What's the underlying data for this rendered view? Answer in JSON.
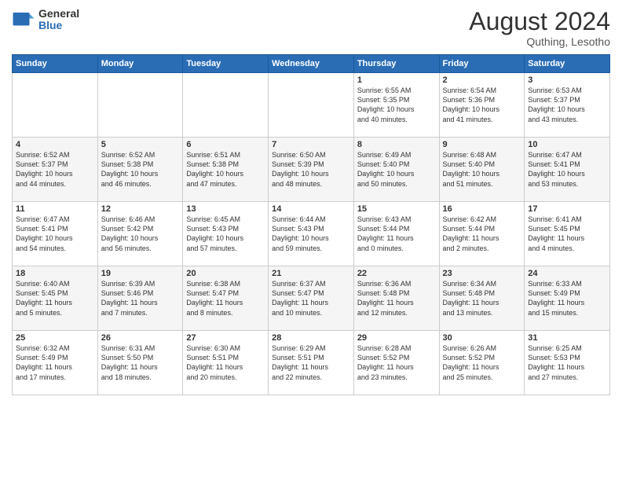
{
  "logo": {
    "general": "General",
    "blue": "Blue"
  },
  "title": {
    "month_year": "August 2024",
    "location": "Quthing, Lesotho"
  },
  "headers": [
    "Sunday",
    "Monday",
    "Tuesday",
    "Wednesday",
    "Thursday",
    "Friday",
    "Saturday"
  ],
  "weeks": [
    [
      {
        "day": "",
        "content": ""
      },
      {
        "day": "",
        "content": ""
      },
      {
        "day": "",
        "content": ""
      },
      {
        "day": "",
        "content": ""
      },
      {
        "day": "1",
        "content": "Sunrise: 6:55 AM\nSunset: 5:35 PM\nDaylight: 10 hours\nand 40 minutes."
      },
      {
        "day": "2",
        "content": "Sunrise: 6:54 AM\nSunset: 5:36 PM\nDaylight: 10 hours\nand 41 minutes."
      },
      {
        "day": "3",
        "content": "Sunrise: 6:53 AM\nSunset: 5:37 PM\nDaylight: 10 hours\nand 43 minutes."
      }
    ],
    [
      {
        "day": "4",
        "content": "Sunrise: 6:52 AM\nSunset: 5:37 PM\nDaylight: 10 hours\nand 44 minutes."
      },
      {
        "day": "5",
        "content": "Sunrise: 6:52 AM\nSunset: 5:38 PM\nDaylight: 10 hours\nand 46 minutes."
      },
      {
        "day": "6",
        "content": "Sunrise: 6:51 AM\nSunset: 5:38 PM\nDaylight: 10 hours\nand 47 minutes."
      },
      {
        "day": "7",
        "content": "Sunrise: 6:50 AM\nSunset: 5:39 PM\nDaylight: 10 hours\nand 48 minutes."
      },
      {
        "day": "8",
        "content": "Sunrise: 6:49 AM\nSunset: 5:40 PM\nDaylight: 10 hours\nand 50 minutes."
      },
      {
        "day": "9",
        "content": "Sunrise: 6:48 AM\nSunset: 5:40 PM\nDaylight: 10 hours\nand 51 minutes."
      },
      {
        "day": "10",
        "content": "Sunrise: 6:47 AM\nSunset: 5:41 PM\nDaylight: 10 hours\nand 53 minutes."
      }
    ],
    [
      {
        "day": "11",
        "content": "Sunrise: 6:47 AM\nSunset: 5:41 PM\nDaylight: 10 hours\nand 54 minutes."
      },
      {
        "day": "12",
        "content": "Sunrise: 6:46 AM\nSunset: 5:42 PM\nDaylight: 10 hours\nand 56 minutes."
      },
      {
        "day": "13",
        "content": "Sunrise: 6:45 AM\nSunset: 5:43 PM\nDaylight: 10 hours\nand 57 minutes."
      },
      {
        "day": "14",
        "content": "Sunrise: 6:44 AM\nSunset: 5:43 PM\nDaylight: 10 hours\nand 59 minutes."
      },
      {
        "day": "15",
        "content": "Sunrise: 6:43 AM\nSunset: 5:44 PM\nDaylight: 11 hours\nand 0 minutes."
      },
      {
        "day": "16",
        "content": "Sunrise: 6:42 AM\nSunset: 5:44 PM\nDaylight: 11 hours\nand 2 minutes."
      },
      {
        "day": "17",
        "content": "Sunrise: 6:41 AM\nSunset: 5:45 PM\nDaylight: 11 hours\nand 4 minutes."
      }
    ],
    [
      {
        "day": "18",
        "content": "Sunrise: 6:40 AM\nSunset: 5:45 PM\nDaylight: 11 hours\nand 5 minutes."
      },
      {
        "day": "19",
        "content": "Sunrise: 6:39 AM\nSunset: 5:46 PM\nDaylight: 11 hours\nand 7 minutes."
      },
      {
        "day": "20",
        "content": "Sunrise: 6:38 AM\nSunset: 5:47 PM\nDaylight: 11 hours\nand 8 minutes."
      },
      {
        "day": "21",
        "content": "Sunrise: 6:37 AM\nSunset: 5:47 PM\nDaylight: 11 hours\nand 10 minutes."
      },
      {
        "day": "22",
        "content": "Sunrise: 6:36 AM\nSunset: 5:48 PM\nDaylight: 11 hours\nand 12 minutes."
      },
      {
        "day": "23",
        "content": "Sunrise: 6:34 AM\nSunset: 5:48 PM\nDaylight: 11 hours\nand 13 minutes."
      },
      {
        "day": "24",
        "content": "Sunrise: 6:33 AM\nSunset: 5:49 PM\nDaylight: 11 hours\nand 15 minutes."
      }
    ],
    [
      {
        "day": "25",
        "content": "Sunrise: 6:32 AM\nSunset: 5:49 PM\nDaylight: 11 hours\nand 17 minutes."
      },
      {
        "day": "26",
        "content": "Sunrise: 6:31 AM\nSunset: 5:50 PM\nDaylight: 11 hours\nand 18 minutes."
      },
      {
        "day": "27",
        "content": "Sunrise: 6:30 AM\nSunset: 5:51 PM\nDaylight: 11 hours\nand 20 minutes."
      },
      {
        "day": "28",
        "content": "Sunrise: 6:29 AM\nSunset: 5:51 PM\nDaylight: 11 hours\nand 22 minutes."
      },
      {
        "day": "29",
        "content": "Sunrise: 6:28 AM\nSunset: 5:52 PM\nDaylight: 11 hours\nand 23 minutes."
      },
      {
        "day": "30",
        "content": "Sunrise: 6:26 AM\nSunset: 5:52 PM\nDaylight: 11 hours\nand 25 minutes."
      },
      {
        "day": "31",
        "content": "Sunrise: 6:25 AM\nSunset: 5:53 PM\nDaylight: 11 hours\nand 27 minutes."
      }
    ]
  ]
}
